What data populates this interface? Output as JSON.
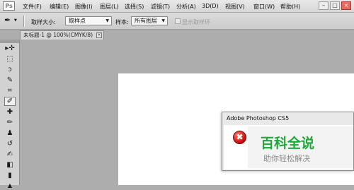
{
  "app": {
    "logo": "Ps"
  },
  "menu": {
    "items": [
      "文件(F)",
      "编辑(E)",
      "图像(I)",
      "图层(L)",
      "选择(S)",
      "滤镜(T)",
      "分析(A)",
      "3D(D)",
      "视图(V)",
      "窗口(W)",
      "帮助(H)"
    ]
  },
  "window_controls": {
    "minimize": "–",
    "maximize": "□",
    "close": "×"
  },
  "options": {
    "sample_size_label": "取样大小:",
    "sample_size_value": "取样点",
    "sample_label": "样本:",
    "sample_value": "所有图层",
    "show_ring_label": "显示取样环"
  },
  "document": {
    "tab_title": "未标题-1 @ 100%(CMYK/8)",
    "close_glyph": "×"
  },
  "tools": {
    "glyphs": [
      "▸✛",
      "⬚",
      "ↄ",
      "✎",
      "⌗",
      "✐",
      "✚",
      "✏",
      "♟",
      "↺",
      "✍",
      "◧",
      "▮",
      "▲"
    ]
  },
  "dialog": {
    "title": "Adobe Photoshop CS5",
    "icon_glyph": "✖"
  },
  "watermark": {
    "title": "百科全说",
    "subtitle": "助你轻松解决"
  },
  "colors": {
    "accent_green": "#1fa83a",
    "error_red": "#d10f0f"
  }
}
